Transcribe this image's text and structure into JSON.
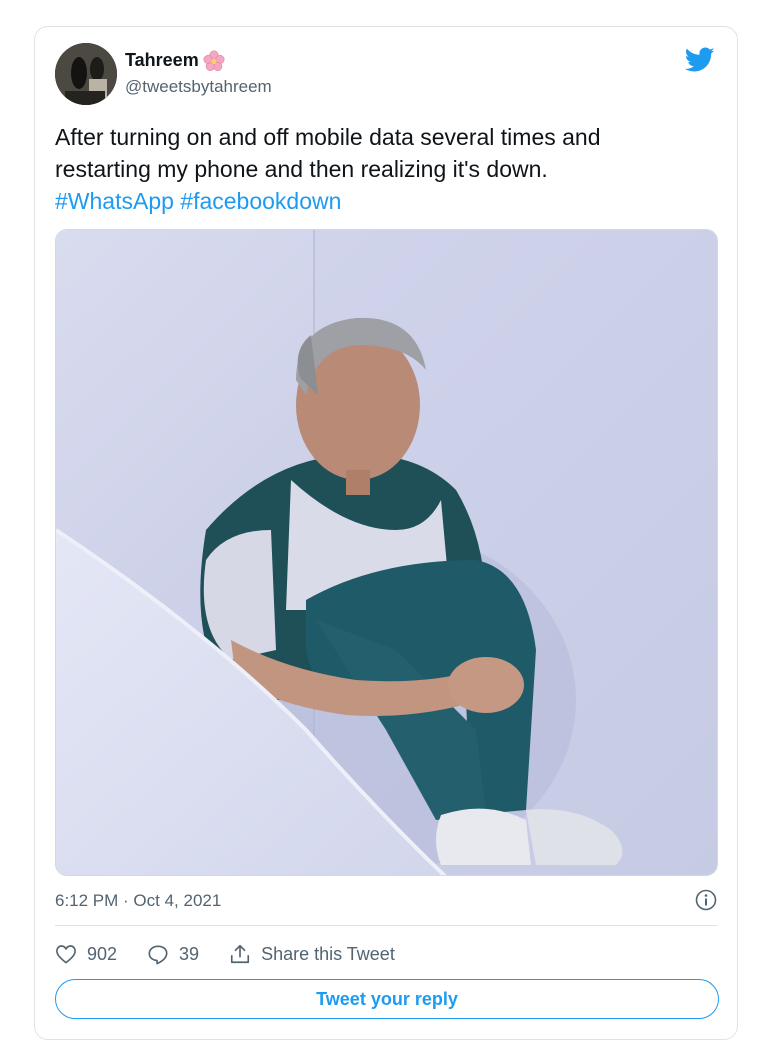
{
  "author": {
    "display_name": "Tahreem",
    "handle": "@tweetsbytahreem",
    "badge_icon": "cherry-blossom-icon"
  },
  "tweet": {
    "text_lines": [
      "After turning on and off mobile data several times and",
      "restarting my phone and then realizing it's down."
    ],
    "hashtags": [
      "#WhatsApp",
      "#facebookdown"
    ]
  },
  "meta": {
    "timestamp": "6:12 PM · Oct 4, 2021"
  },
  "actions": {
    "likes": "902",
    "replies": "39",
    "share_label": "Share this Tweet"
  },
  "reply_button": {
    "label": "Tweet your reply"
  },
  "colors": {
    "accent": "#1d9bf0",
    "text_primary": "#0f1419",
    "text_secondary": "#536471",
    "border": "#dfe3e6"
  },
  "icons": {
    "brand": "twitter-bird-icon",
    "like": "heart-icon",
    "reply": "reply-bubble-icon",
    "share": "share-upload-icon",
    "info": "info-icon"
  }
}
